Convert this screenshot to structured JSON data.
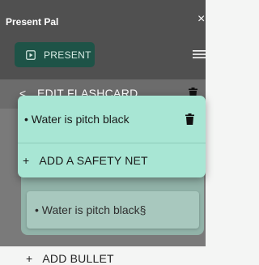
{
  "app": {
    "title": "Present Pal",
    "close_glyph": "×"
  },
  "toolbar": {
    "present_label": "PRESENT",
    "menu_icon": "hamburger-icon"
  },
  "editor": {
    "back_glyph": "<",
    "title": "EDIT FLASHCARD",
    "bullets": [
      {
        "text": "Water is pitch black§"
      }
    ],
    "add_bullet_label": "ADD BULLET",
    "plus_glyph": "+"
  },
  "context_menu": {
    "item_text": "Water is pitch black",
    "add_safety_net_label": "ADD A SAFETY NET",
    "plus_glyph": "+"
  },
  "colors": {
    "header": "#505050",
    "present_button": "#1e5347",
    "popup": "#a8e6d4",
    "flashcard": "#91b2a8"
  }
}
